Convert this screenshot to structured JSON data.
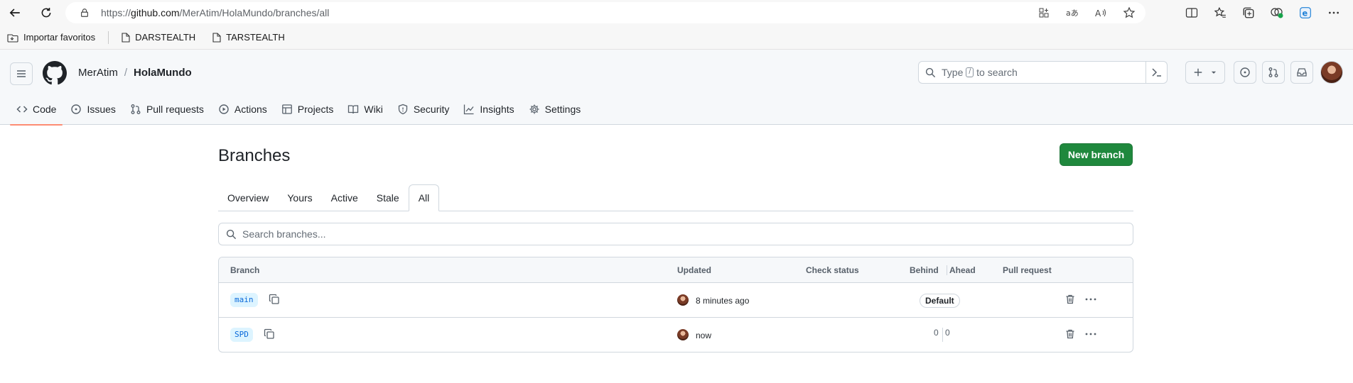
{
  "browser": {
    "url_prefix": "https://",
    "url_domain": "github.com",
    "url_path": "/MerAtim/HolaMundo/branches/all",
    "bookmarks": [
      "Importar favoritos",
      "DARSTEALTH",
      "TARSTEALTH"
    ]
  },
  "repo": {
    "owner": "MerAtim",
    "separator": "/",
    "name": "HolaMundo"
  },
  "search": {
    "placeholder_before": "Type",
    "placeholder_key": "/",
    "placeholder_after": "to search"
  },
  "nav": {
    "tabs": [
      {
        "label": "Code",
        "icon": "code-icon",
        "active": true
      },
      {
        "label": "Issues",
        "icon": "issue-icon"
      },
      {
        "label": "Pull requests",
        "icon": "pull-request-icon"
      },
      {
        "label": "Actions",
        "icon": "play-icon"
      },
      {
        "label": "Projects",
        "icon": "table-icon"
      },
      {
        "label": "Wiki",
        "icon": "book-icon"
      },
      {
        "label": "Security",
        "icon": "shield-icon"
      },
      {
        "label": "Insights",
        "icon": "graph-icon"
      },
      {
        "label": "Settings",
        "icon": "gear-icon"
      }
    ]
  },
  "page": {
    "title": "Branches",
    "new_branch_label": "New branch",
    "subtabs": [
      "Overview",
      "Yours",
      "Active",
      "Stale",
      "All"
    ],
    "active_subtab": "All",
    "search_placeholder": "Search branches..."
  },
  "table": {
    "headers": {
      "branch": "Branch",
      "updated": "Updated",
      "check_status": "Check status",
      "behind": "Behind",
      "ahead": "Ahead",
      "pull_request": "Pull request"
    },
    "rows": [
      {
        "name": "main",
        "updated": "8 minutes ago",
        "default_badge": "Default"
      },
      {
        "name": "SPD",
        "updated": "now",
        "behind": "0",
        "ahead": "0"
      }
    ]
  },
  "colors": {
    "accent_green": "#1f883d",
    "active_tab_underline": "#fd8c73",
    "branch_pill_bg": "#ddf4ff",
    "branch_pill_text": "#0969da"
  }
}
